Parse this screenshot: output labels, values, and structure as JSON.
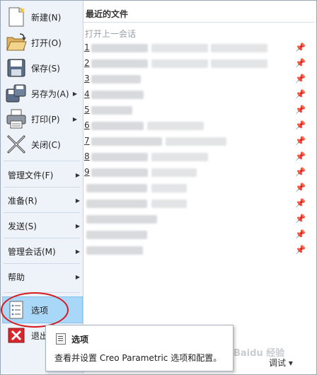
{
  "file_menu": {
    "items": [
      {
        "label": "新建(N)",
        "icon": "new-doc-icon"
      },
      {
        "label": "打开(O)",
        "icon": "folder-open-icon"
      },
      {
        "label": "保存(S)",
        "icon": "floppy-icon"
      },
      {
        "label": "另存为(A)",
        "icon": "save-as-icon"
      },
      {
        "label": "打印(P)",
        "icon": "printer-icon"
      },
      {
        "label": "关闭(C)",
        "icon": "close-x-icon"
      }
    ],
    "text_items": [
      {
        "label": "管理文件(F)"
      },
      {
        "label": "准备(R)"
      },
      {
        "label": "发送(S)"
      },
      {
        "label": "管理会话(M)"
      },
      {
        "label": "帮助"
      }
    ],
    "options_label": "选项",
    "exit_label": "退出"
  },
  "recent": {
    "title": "最近的文件",
    "open_last_session": "打开上一会话",
    "numbers": [
      "1",
      "2",
      "3",
      "4",
      "5",
      "6",
      "7",
      "8",
      "9"
    ]
  },
  "tooltip": {
    "title": "选项",
    "description": "查看并设置 Creo Parametric 选项和配置。"
  },
  "status": {
    "debug_label": "调试 ▾"
  },
  "watermark": "Baidu 经验",
  "colors": {
    "selected_bg": "#a9d7f7",
    "highlight_ring": "#d6191c",
    "exit_icon_bg": "#d9262c"
  }
}
